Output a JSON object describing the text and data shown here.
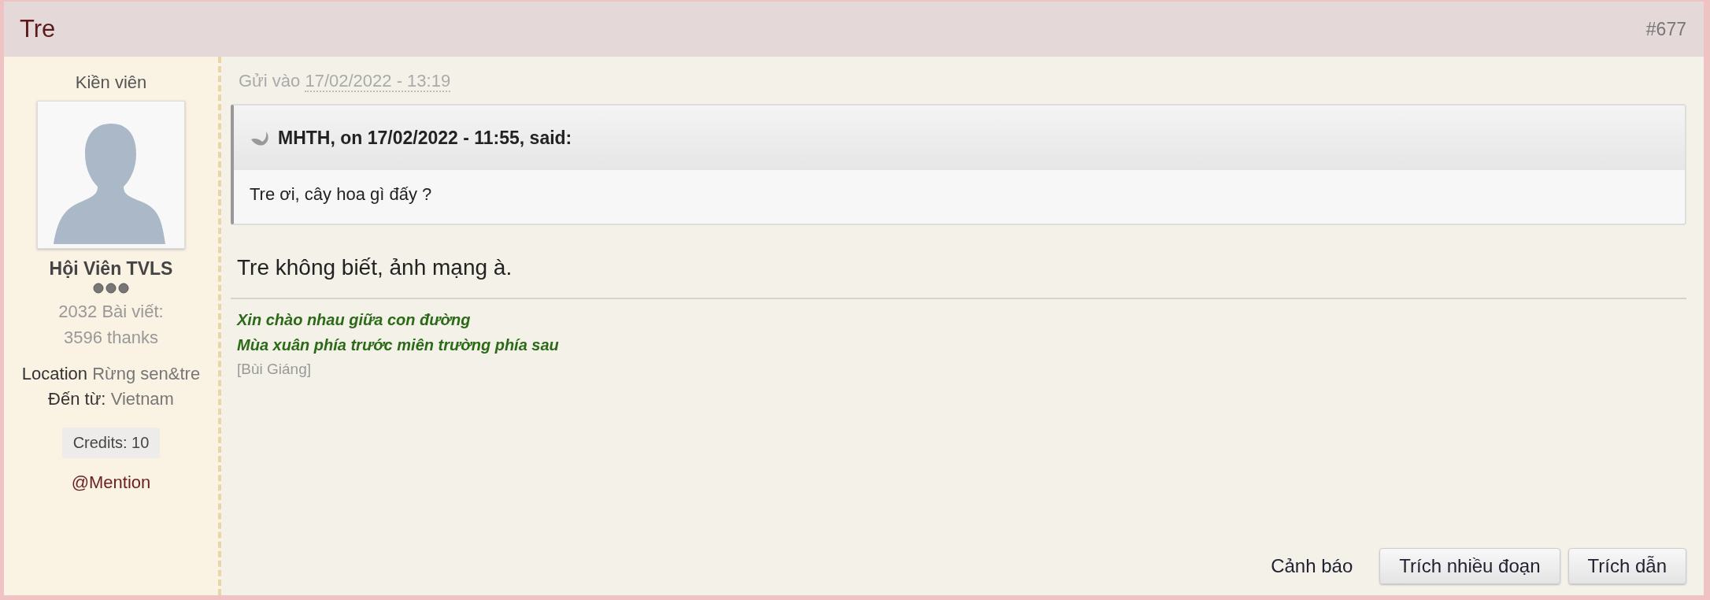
{
  "post": {
    "title": "Tre",
    "number": "#677"
  },
  "author": {
    "rank": "Kiền viên",
    "group": "Hội Viên TVLS",
    "posts": "2032 Bài viết:",
    "thanks": "3596 thanks",
    "location_label": "Location",
    "location": "Rừng sen&tre",
    "from_label": "Đến từ:",
    "from": "Vietnam",
    "credits": "Credits: 10",
    "mention": "@Mention"
  },
  "meta": {
    "label": "Gửi vào",
    "date": "17/02/2022 - 13:19"
  },
  "quote": {
    "citation": "MHTH, on 17/02/2022 - 11:55, said:",
    "text": "Tre ơi, cây hoa gì đấy ?"
  },
  "body": "Tre không biết, ảnh mạng à.",
  "signature": {
    "lines": [
      "Xin chào nhau giữa con đường",
      "Mùa xuân phía trước miên trường phía sau"
    ],
    "source": "[Bùi Giáng]"
  },
  "actions": {
    "report": "Cảnh báo",
    "buttons": [
      "Trích nhiều đoạn",
      "Trích dẫn"
    ]
  }
}
